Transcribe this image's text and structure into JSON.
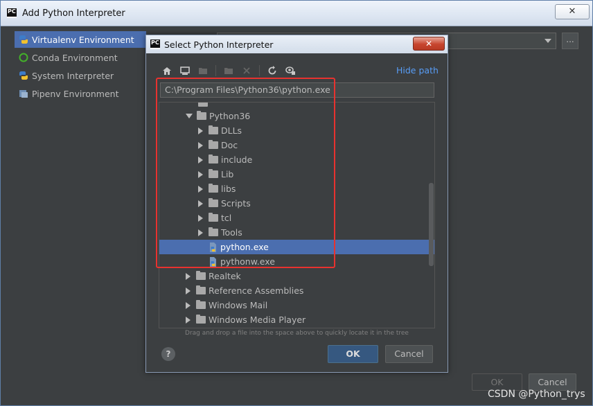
{
  "outer_window": {
    "title": "Add Python Interpreter",
    "close_glyph": "✕",
    "environments": [
      {
        "label": "Virtualenv Environment",
        "icon": "virtualenv-icon"
      },
      {
        "label": "Conda Environment",
        "icon": "conda-icon"
      },
      {
        "label": "System Interpreter",
        "icon": "python-icon"
      },
      {
        "label": "Pipenv Environment",
        "icon": "pipenv-icon"
      }
    ],
    "browse_label": "...",
    "ok_label": "OK",
    "cancel_label": "Cancel"
  },
  "dialog": {
    "title": "Select Python Interpreter",
    "close_glyph": "✕",
    "toolbar": {
      "icons": [
        "home-icon",
        "desktop-icon",
        "new-folder-icon",
        "move-icon",
        "delete-icon",
        "refresh-icon",
        "show-hidden-icon"
      ]
    },
    "hide_path_label": "Hide path",
    "path_value": "C:\\Program Files\\Python36\\python.exe",
    "tree": [
      {
        "label": "Python36",
        "type": "folder",
        "expanded": true,
        "indent": 1
      },
      {
        "label": "DLLs",
        "type": "folder",
        "expanded": false,
        "indent": 2
      },
      {
        "label": "Doc",
        "type": "folder",
        "expanded": false,
        "indent": 2
      },
      {
        "label": "include",
        "type": "folder",
        "expanded": false,
        "indent": 2
      },
      {
        "label": "Lib",
        "type": "folder",
        "expanded": false,
        "indent": 2
      },
      {
        "label": "libs",
        "type": "folder",
        "expanded": false,
        "indent": 2
      },
      {
        "label": "Scripts",
        "type": "folder",
        "expanded": false,
        "indent": 2
      },
      {
        "label": "tcl",
        "type": "folder",
        "expanded": false,
        "indent": 2
      },
      {
        "label": "Tools",
        "type": "folder",
        "expanded": false,
        "indent": 2
      },
      {
        "label": "python.exe",
        "type": "file",
        "selected": true,
        "indent": 2
      },
      {
        "label": "pythonw.exe",
        "type": "file",
        "indent": 2
      },
      {
        "label": "Realtek",
        "type": "folder",
        "expanded": false,
        "indent": 1
      },
      {
        "label": "Reference Assemblies",
        "type": "folder",
        "expanded": false,
        "indent": 1
      },
      {
        "label": "Windows Mail",
        "type": "folder",
        "expanded": false,
        "indent": 1
      },
      {
        "label": "Windows Media Player",
        "type": "folder",
        "expanded": false,
        "indent": 1
      }
    ],
    "hint": "Drag and drop a file into the space above to quickly locate it in the tree",
    "help_label": "?",
    "ok_label": "OK",
    "cancel_label": "Cancel"
  },
  "watermark": "CSDN @Python_trys",
  "colors": {
    "selection": "#4b6eaf",
    "link": "#589df6",
    "highlight_box": "#e8322f"
  }
}
